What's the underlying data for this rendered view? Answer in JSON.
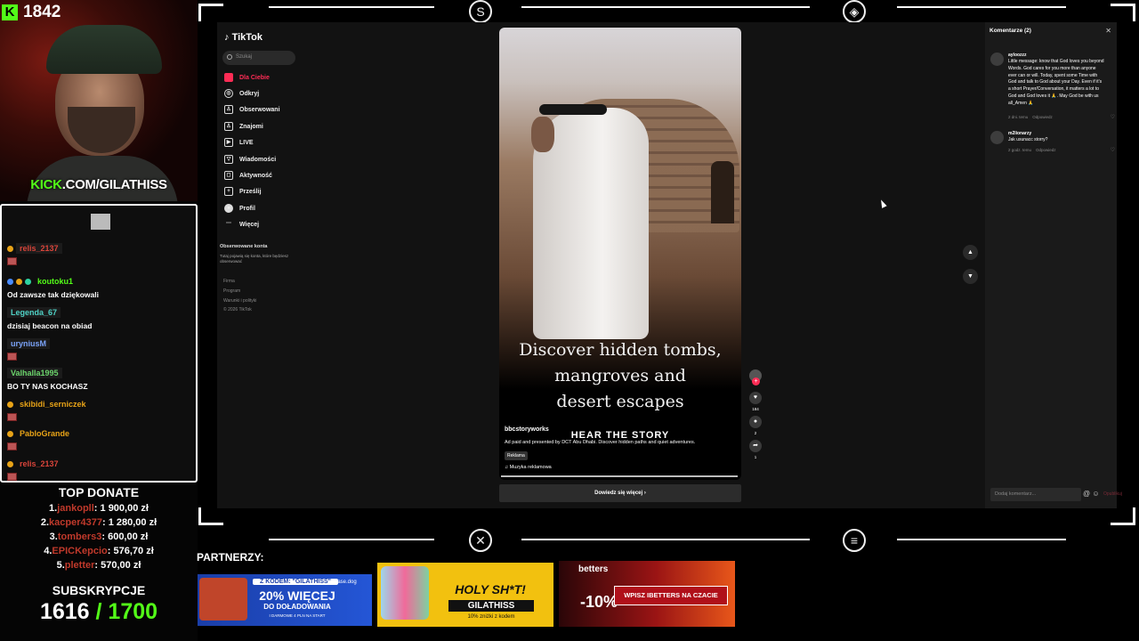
{
  "stream": {
    "viewer_count": "1842",
    "kick_url_prefix": "KICK",
    "kick_url_rest": ".COM/GILATHISS",
    "kick_logo_letter": "K"
  },
  "chat": {
    "messages": [
      {
        "user": "relis_2137",
        "text": "",
        "user_color": "#d9443a"
      },
      {
        "user": "koutoku1",
        "text": "Od zawsze tak dziękowali",
        "user_color": "#53fc18"
      },
      {
        "user": "Legenda_67",
        "text": "dzisiaj beacon na obiad",
        "user_color": "#4fd1c5"
      },
      {
        "user": "uryniusM",
        "text": "",
        "user_color": "#7aa2f7"
      },
      {
        "user": "Valhalla1995",
        "text": "BO TY NAS KOCHASZ",
        "user_color": "#6bd36b"
      },
      {
        "user": "skibidi_serniczek",
        "text": "",
        "user_color": "#e8a317"
      },
      {
        "user": "PabloGrande",
        "text": "",
        "user_color": "#e8a317"
      },
      {
        "user": "relis_2137",
        "text": "",
        "user_color": "#d9443a"
      }
    ]
  },
  "top_donate": {
    "title": "TOP DONATE",
    "entries": [
      {
        "rank": "1.",
        "name": "jankopll",
        "amount": ": 1 900,00 zł"
      },
      {
        "rank": "2.",
        "name": "kacper4377",
        "amount": ": 1 280,00 zł"
      },
      {
        "rank": "3.",
        "name": "tombers3",
        "amount": ": 600,00 zł"
      },
      {
        "rank": "4.",
        "name": "EPICKepcio",
        "amount": ": 576,70 zł"
      },
      {
        "rank": "5.",
        "name": "pletter",
        "amount": ": 570,00 zł"
      }
    ]
  },
  "subs": {
    "title": "SUBSKRYPCJE",
    "current": "1616",
    "goal": " / 1700"
  },
  "tiktok": {
    "logo": "TikTok",
    "search_placeholder": "Szukaj",
    "nav": [
      {
        "label": "Dla Ciebie",
        "icon": "home-icon",
        "glyph": "⌂"
      },
      {
        "label": "Odkryj",
        "icon": "compass-icon",
        "glyph": "◎"
      },
      {
        "label": "Obserwowani",
        "icon": "following-icon",
        "glyph": "♙"
      },
      {
        "label": "Znajomi",
        "icon": "friends-icon",
        "glyph": "♙"
      },
      {
        "label": "LIVE",
        "icon": "live-icon",
        "glyph": "▶"
      },
      {
        "label": "Wiadomości",
        "icon": "messages-icon",
        "glyph": "▽"
      },
      {
        "label": "Aktywność",
        "icon": "activity-icon",
        "glyph": "◻"
      },
      {
        "label": "Prześlij",
        "icon": "upload-icon",
        "glyph": "+"
      },
      {
        "label": "Profil",
        "icon": "profile-icon",
        "glyph": "●"
      },
      {
        "label": "Więcej",
        "icon": "more-icon",
        "glyph": "⋯"
      }
    ],
    "followed_title": "Obserwowane konta",
    "followed_desc": "Tutaj pojawią się konta, które będziesz obserwować",
    "footer": [
      "Firma",
      "Program",
      "Warunki i polityki",
      "© 2026 TikTok"
    ],
    "video": {
      "headline_lines": [
        "Discover hidden tombs,",
        "mangroves and",
        "desert escapes"
      ],
      "cta": "HEAR THE STORY",
      "author": "bbcstoryworks",
      "description": "Ad paid and presented by DCT Abu Dhabi. Discover hidden paths and quiet adventures.",
      "tag": "Reklama",
      "music": "♫ Muzyka reklamowa",
      "progress": 1.0
    },
    "learn_more": "Dowiedz się więcej  ›",
    "actions": {
      "likes": "184",
      "comments": "2",
      "shares": "1"
    },
    "comments_panel": {
      "title": "Komentarze (2)",
      "close": "✕",
      "items": [
        {
          "user": "ayloozzz",
          "text": "Little message: know that God loves you beyond Words. God cares for you more than anyone ever can or will. Today, spent some Time with God and talk to God about your Day. Even if it's a short Prayer/Conversation, it matters a lot to God and God loves it 🙏. May God be with us all_Amen 🙏",
          "time": "2 dni. temu",
          "reply": "Odpowiedz"
        },
        {
          "user": "m2lionarzy",
          "text": "Jak usunacc storry?",
          "time": "2 godz. temu",
          "reply": "Odpowiedz"
        }
      ],
      "input_placeholder": "Dodaj komentarz...",
      "post_label": "Opublikuj"
    }
  },
  "partners": {
    "label": "PARTNERZY:",
    "p1": {
      "code": "Z KODEM: \"GILATHISS\"",
      "big": "20% WIĘCEJ",
      "sub": "DO DOŁADOWANIA",
      "small": "I DARMOWE 4 PLN NA START",
      "brand": "Case.dog"
    },
    "p2": {
      "title": "HOLY SH*T!",
      "code": "GILATHISS",
      "small": "10% zniżki z kodem"
    },
    "p3": {
      "brand": "betters",
      "pct": "-10%",
      "button": "WPISZ IBETTERS NA CZACIE"
    }
  },
  "colors": {
    "kick_green": "#53fc18",
    "tiktok_red": "#fe2c55",
    "donor_red": "#c0392b"
  }
}
